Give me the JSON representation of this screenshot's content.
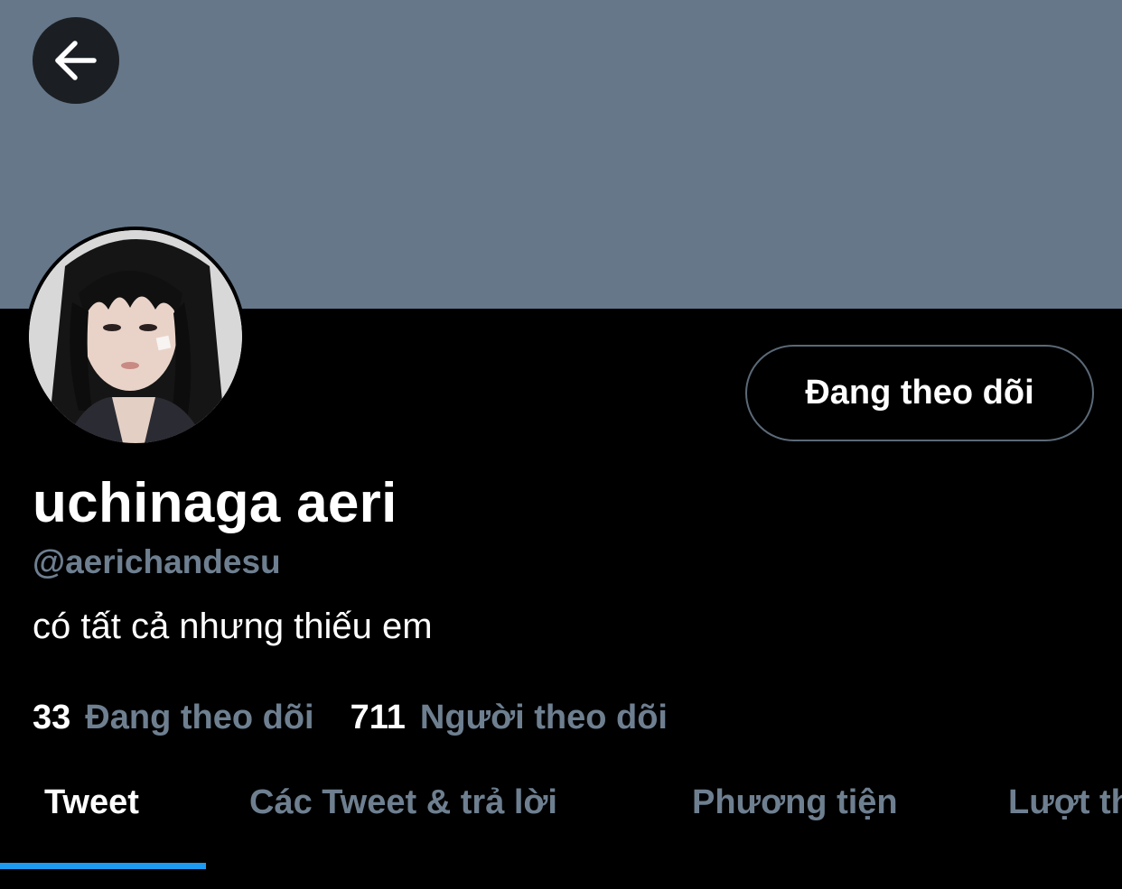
{
  "header": {
    "back_icon": "arrow-left-icon",
    "banner_color": "#66778a"
  },
  "profile": {
    "avatar_icon": "profile-photo",
    "follow_button_label": "Đang theo dõi",
    "display_name": "uchinaga aeri",
    "handle": "@aerichandesu",
    "bio": "có tất cả nhưng thiếu em"
  },
  "stats": {
    "following_count": "33",
    "following_label": "Đang theo dõi",
    "followers_count": "711",
    "followers_label": "Người theo dõi"
  },
  "tabs": [
    {
      "label": "Tweet"
    },
    {
      "label": "Các Tweet & trả lời"
    },
    {
      "label": "Phương tiện"
    },
    {
      "label": "Lượt thích"
    }
  ],
  "colors": {
    "accent": "#1d9bf0",
    "secondary_text": "#6e7f90",
    "background": "#000000"
  }
}
